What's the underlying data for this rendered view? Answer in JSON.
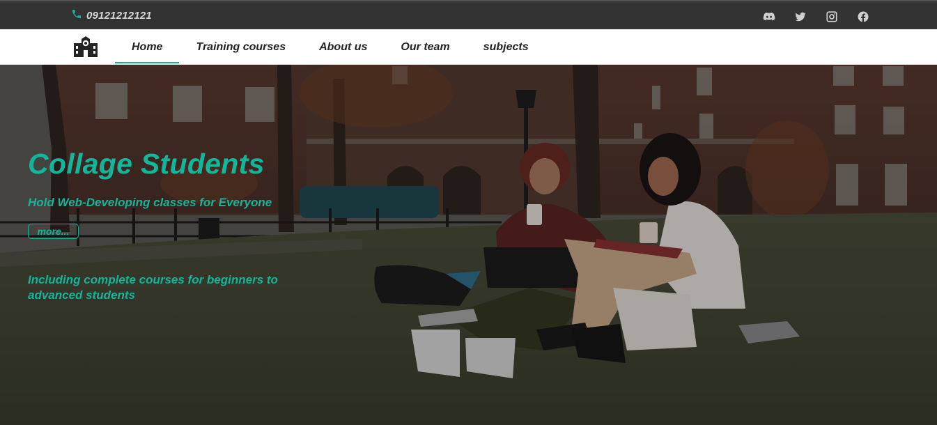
{
  "topbar": {
    "phone": "09121212121",
    "socials": [
      "discord-icon",
      "twitter-icon",
      "instagram-icon",
      "facebook-icon"
    ]
  },
  "nav": {
    "items": [
      "Home",
      "Training courses",
      "About us",
      "Our team",
      "subjects"
    ],
    "active": "Home"
  },
  "hero": {
    "title": "Collage Students",
    "subtitle": "Hold Web-Developing classes for Everyone",
    "button": "more...",
    "description": "Including complete courses for beginners to advanced students"
  },
  "colors": {
    "accent": "#13b59b",
    "topbar": "#333333",
    "navbar": "#ffffff"
  }
}
